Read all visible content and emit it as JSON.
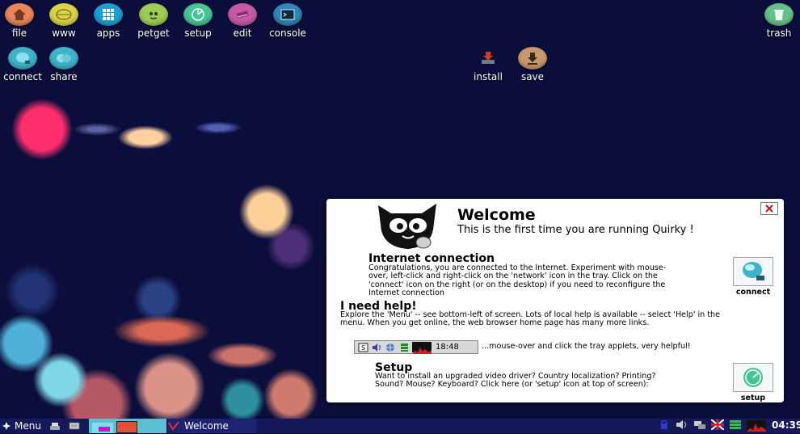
{
  "desktop": {
    "icons": [
      {
        "label": "file",
        "icon": "home-icon",
        "color": "#e8855a"
      },
      {
        "label": "www",
        "icon": "globe-icon",
        "color": "#d9d34a"
      },
      {
        "label": "apps",
        "icon": "apps-grid-icon",
        "color": "#1a9fd6"
      },
      {
        "label": "petget",
        "icon": "petget-icon",
        "color": "#9ccc55"
      },
      {
        "label": "setup",
        "icon": "setup-icon",
        "color": "#45c495"
      },
      {
        "label": "edit",
        "icon": "edit-icon",
        "color": "#c65aa6"
      },
      {
        "label": "console",
        "icon": "console-icon",
        "color": "#2f86b8"
      },
      {
        "label": "trash",
        "icon": "trash-icon",
        "color": "#66c08a"
      },
      {
        "label": "connect",
        "icon": "connect-icon",
        "color": "#3fb3c9"
      },
      {
        "label": "share",
        "icon": "share-icon",
        "color": "#3fb3c9"
      },
      {
        "label": "install",
        "icon": "install-icon",
        "color": "#d33a1e"
      },
      {
        "label": "save",
        "icon": "save-icon",
        "color": "#c79a6b"
      }
    ]
  },
  "welcome": {
    "title": "Welcome",
    "subtitle": "This is the first time you are running Quirky !",
    "internet": {
      "heading": "Internet connection",
      "lines": [
        "Congratulations, you are connected to the Internet. Experiment with mouse-",
        "over, left-click and right-click on the 'network' icon in the tray. Click on the",
        "'connect' icon on the right (or on the desktop) if you need to reconfigure the",
        "Internet connection"
      ],
      "button_label": "connect"
    },
    "help": {
      "heading": "I need help!",
      "lines": [
        "Explore the 'Menu' -- see bottom-left of screen. Lots of local help is available -- select 'Help' in the",
        "menu. When you get online, the web browser home page has many more links."
      ]
    },
    "tray_demo": {
      "time": "18:48",
      "hint": "...mouse-over and click the tray applets, very helpful!"
    },
    "setup": {
      "heading": "Setup",
      "lines": [
        "Want to install an upgraded video driver? Country localization? Printing?",
        "Sound? Mouse? Keyboard? Click here (or 'setup' icon at top of screen):"
      ],
      "button_label": "setup"
    }
  },
  "taskbar": {
    "menu_label": "Menu",
    "window_label": "Welcome",
    "clock": "04:39"
  }
}
